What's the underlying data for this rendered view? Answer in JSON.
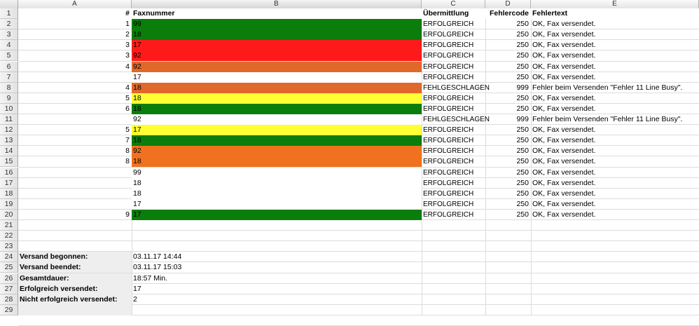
{
  "columns": [
    "A",
    "B",
    "C",
    "D",
    "E"
  ],
  "headers": {
    "hash": "#",
    "fax": "Faxnummer",
    "transfer": "Übermittlung",
    "code": "Fehlercode",
    "text": "Fehlertext"
  },
  "colors": {
    "green": "#0b7d0b",
    "red": "#ff1a1a",
    "orange": "#f0721e",
    "dark_orange": "#e0682b",
    "yellow": "#ffff33",
    "summary_bg": "#eeeeee"
  },
  "rows": [
    {
      "n": "1",
      "fax": "99",
      "color": "green",
      "status": "ERFOLGREICH",
      "code": "250",
      "text": "OK, Fax versendet."
    },
    {
      "n": "2",
      "fax": "18",
      "color": "green",
      "status": "ERFOLGREICH",
      "code": "250",
      "text": "OK, Fax versendet."
    },
    {
      "n": "3",
      "fax": "17",
      "color": "red",
      "status": "ERFOLGREICH",
      "code": "250",
      "text": "OK, Fax versendet."
    },
    {
      "n": "3",
      "fax": "92",
      "color": "red",
      "status": "ERFOLGREICH",
      "code": "250",
      "text": "OK, Fax versendet."
    },
    {
      "n": "4",
      "fax": "92",
      "color": "dark_orange",
      "status": "ERFOLGREICH",
      "code": "250",
      "text": "OK, Fax versendet."
    },
    {
      "n": "",
      "fax": "17",
      "color": "",
      "status": "ERFOLGREICH",
      "code": "250",
      "text": "OK, Fax versendet."
    },
    {
      "n": "4",
      "fax": "18",
      "color": "dark_orange",
      "status": "FEHLGESCHLAGEN",
      "code": "999",
      "text": "Fehler beim Versenden \"Fehler 11 Line Busy\"."
    },
    {
      "n": "5",
      "fax": "18",
      "color": "yellow",
      "status": "ERFOLGREICH",
      "code": "250",
      "text": "OK, Fax versendet."
    },
    {
      "n": "6",
      "fax": "18",
      "color": "green",
      "status": "ERFOLGREICH",
      "code": "250",
      "text": "OK, Fax versendet."
    },
    {
      "n": "",
      "fax": "92",
      "color": "",
      "status": "FEHLGESCHLAGEN",
      "code": "999",
      "text": "Fehler beim Versenden \"Fehler 11 Line Busy\"."
    },
    {
      "n": "5",
      "fax": "17",
      "color": "yellow",
      "status": "ERFOLGREICH",
      "code": "250",
      "text": "OK, Fax versendet."
    },
    {
      "n": "7",
      "fax": "18",
      "color": "green",
      "status": "ERFOLGREICH",
      "code": "250",
      "text": "OK, Fax versendet."
    },
    {
      "n": "8",
      "fax": "92",
      "color": "orange",
      "status": "ERFOLGREICH",
      "code": "250",
      "text": "OK, Fax versendet."
    },
    {
      "n": "8",
      "fax": "18",
      "color": "orange",
      "status": "ERFOLGREICH",
      "code": "250",
      "text": "OK, Fax versendet."
    },
    {
      "n": "",
      "fax": "99",
      "color": "",
      "status": "ERFOLGREICH",
      "code": "250",
      "text": "OK, Fax versendet."
    },
    {
      "n": "",
      "fax": "18",
      "color": "",
      "status": "ERFOLGREICH",
      "code": "250",
      "text": "OK, Fax versendet."
    },
    {
      "n": "",
      "fax": "18",
      "color": "",
      "status": "ERFOLGREICH",
      "code": "250",
      "text": "OK, Fax versendet."
    },
    {
      "n": "",
      "fax": "17",
      "color": "",
      "status": "ERFOLGREICH",
      "code": "250",
      "text": "OK, Fax versendet."
    },
    {
      "n": "9",
      "fax": "17",
      "color": "green",
      "status": "ERFOLGREICH",
      "code": "250",
      "text": "OK, Fax versendet."
    }
  ],
  "summary": [
    {
      "label": "Versand begonnen:",
      "value": "03.11.17 14:44"
    },
    {
      "label": "Versand beendet:",
      "value": "03.11.17 15:03"
    },
    {
      "label": "Gesamtdauer:",
      "value": "18:57 Min."
    },
    {
      "label": "Erfolgreich versendet:",
      "value": "17"
    },
    {
      "label": "Nicht erfolgreich versendet:",
      "value": "2"
    }
  ],
  "row_numbers": [
    "1",
    "2",
    "3",
    "4",
    "5",
    "6",
    "7",
    "8",
    "9",
    "10",
    "11",
    "12",
    "13",
    "14",
    "15",
    "16",
    "17",
    "18",
    "19",
    "20",
    "21",
    "22",
    "23",
    "24",
    "25",
    "26",
    "27",
    "28",
    "29"
  ]
}
